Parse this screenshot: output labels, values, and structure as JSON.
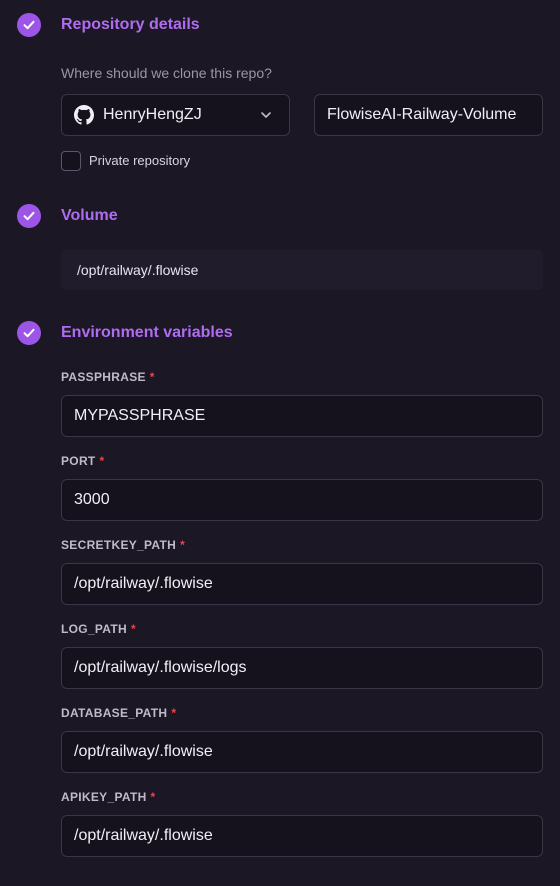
{
  "colors": {
    "accent": "#9d55e8",
    "title": "#b06cf0",
    "background": "#1b1725",
    "required": "#e5484d"
  },
  "repository": {
    "title": "Repository details",
    "hint": "Where should we clone this repo?",
    "owner": "HenryHengZJ",
    "owner_icon": "github-icon",
    "repo_name": "FlowiseAI-Railway-Volume",
    "private_label": "Private repository",
    "private_checked": false
  },
  "volume": {
    "title": "Volume",
    "mount_path": "/opt/railway/.flowise"
  },
  "env": {
    "title": "Environment variables",
    "required_marker": "*",
    "vars": [
      {
        "name": "PASSPHRASE",
        "value": "MYPASSPHRASE"
      },
      {
        "name": "PORT",
        "value": "3000"
      },
      {
        "name": "SECRETKEY_PATH",
        "value": "/opt/railway/.flowise"
      },
      {
        "name": "LOG_PATH",
        "value": "/opt/railway/.flowise/logs"
      },
      {
        "name": "DATABASE_PATH",
        "value": "/opt/railway/.flowise"
      },
      {
        "name": "APIKEY_PATH",
        "value": "/opt/railway/.flowise"
      }
    ]
  }
}
